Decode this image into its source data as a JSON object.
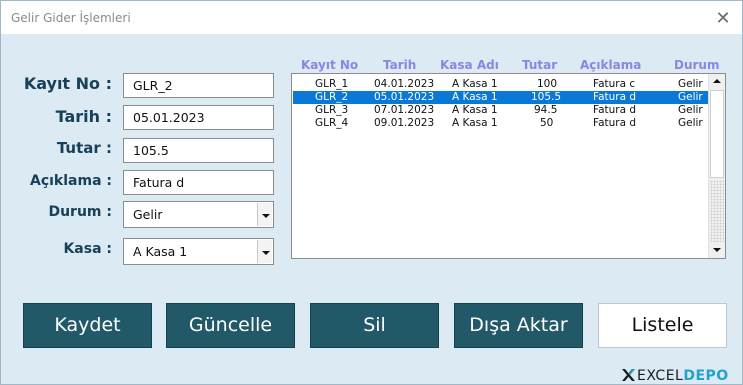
{
  "window": {
    "title": "Gelir Gider İşlemleri",
    "close_glyph": "✕"
  },
  "form": {
    "kayit_no": {
      "label": "Kayıt No :",
      "value": "GLR_2"
    },
    "tarih": {
      "label": "Tarih :",
      "value": "05.01.2023"
    },
    "tutar": {
      "label": "Tutar :",
      "value": "105.5"
    },
    "aciklama": {
      "label": "Açıklama :",
      "value": "Fatura d"
    },
    "durum": {
      "label": "Durum :",
      "value": "Gelir"
    },
    "kasa": {
      "label": "Kasa :",
      "value": "A Kasa 1"
    }
  },
  "list": {
    "headers": [
      "Kayıt No",
      "Tarih",
      "Kasa Adı",
      "Tutar",
      "Açıklama",
      "Durum"
    ],
    "rows": [
      [
        "GLR_1",
        "04.01.2023",
        "A Kasa 1",
        "100",
        "Fatura c",
        "Gelir"
      ],
      [
        "GLR_2",
        "05.01.2023",
        "A Kasa 1",
        "105.5",
        "Fatura d",
        "Gelir"
      ],
      [
        "GLR_3",
        "07.01.2023",
        "A Kasa 1",
        "94.5",
        "Fatura d",
        "Gelir"
      ],
      [
        "GLR_4",
        "09.01.2023",
        "A Kasa 1",
        "50",
        "Fatura d",
        "Gelir"
      ]
    ],
    "selected_row": "GLR_2"
  },
  "buttons": {
    "kaydet": "Kaydet",
    "guncelle": "Güncelle",
    "sil": "Sil",
    "disa_aktar": "Dışa Aktar",
    "listele": "Listele"
  },
  "logo": {
    "part1": "EXCEL",
    "part2": "DEPO"
  },
  "colors": {
    "window_bg": "#dbeaf3",
    "label": "#17405a",
    "header": "#8a86e3",
    "button": "#215968",
    "selection": "#0a78d7",
    "logo_accent": "#23a2cc"
  },
  "icons": [
    "close-icon",
    "dropdown-arrow-icon",
    "scroll-up-icon",
    "scroll-down-icon",
    "excel-depo-logo-icon"
  ]
}
